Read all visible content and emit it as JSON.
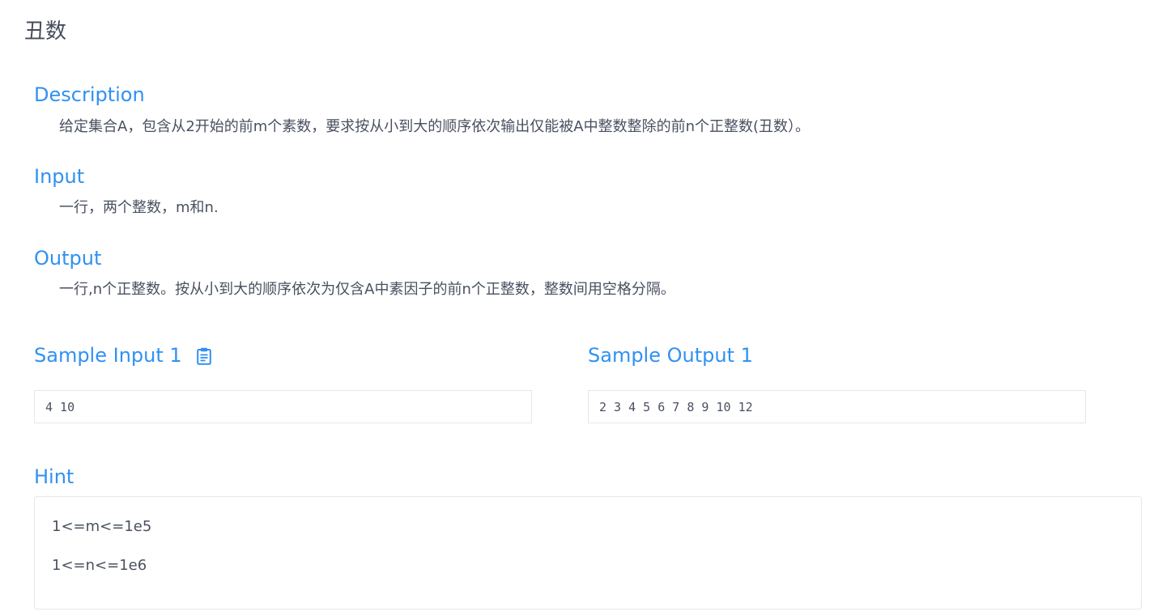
{
  "page": {
    "title": "丑数"
  },
  "description": {
    "heading": "Description",
    "text": "给定集合A，包含从2开始的前m个素数，要求按从小到大的顺序依次输出仅能被A中整数整除的前n个正整数(丑数）。"
  },
  "input": {
    "heading": "Input",
    "text": "一行，两个整数，m和n."
  },
  "output": {
    "heading": "Output",
    "text": "一行,n个正整数。按从小到大的顺序依次为仅含A中素因子的前n个正整数，整数间用空格分隔。"
  },
  "sample_input": {
    "heading": "Sample Input 1",
    "icon": "clipboard-icon",
    "value": "4 10"
  },
  "sample_output": {
    "heading": "Sample Output 1",
    "value": "2 3 4 5 6 7 8 9 10 12"
  },
  "hint": {
    "heading": "Hint",
    "lines": [
      "1<=m<=1e5",
      "1<=n<=1e6"
    ]
  },
  "colors": {
    "accent": "#3091f2",
    "text": "#495060",
    "border": "#e3e8ee"
  }
}
